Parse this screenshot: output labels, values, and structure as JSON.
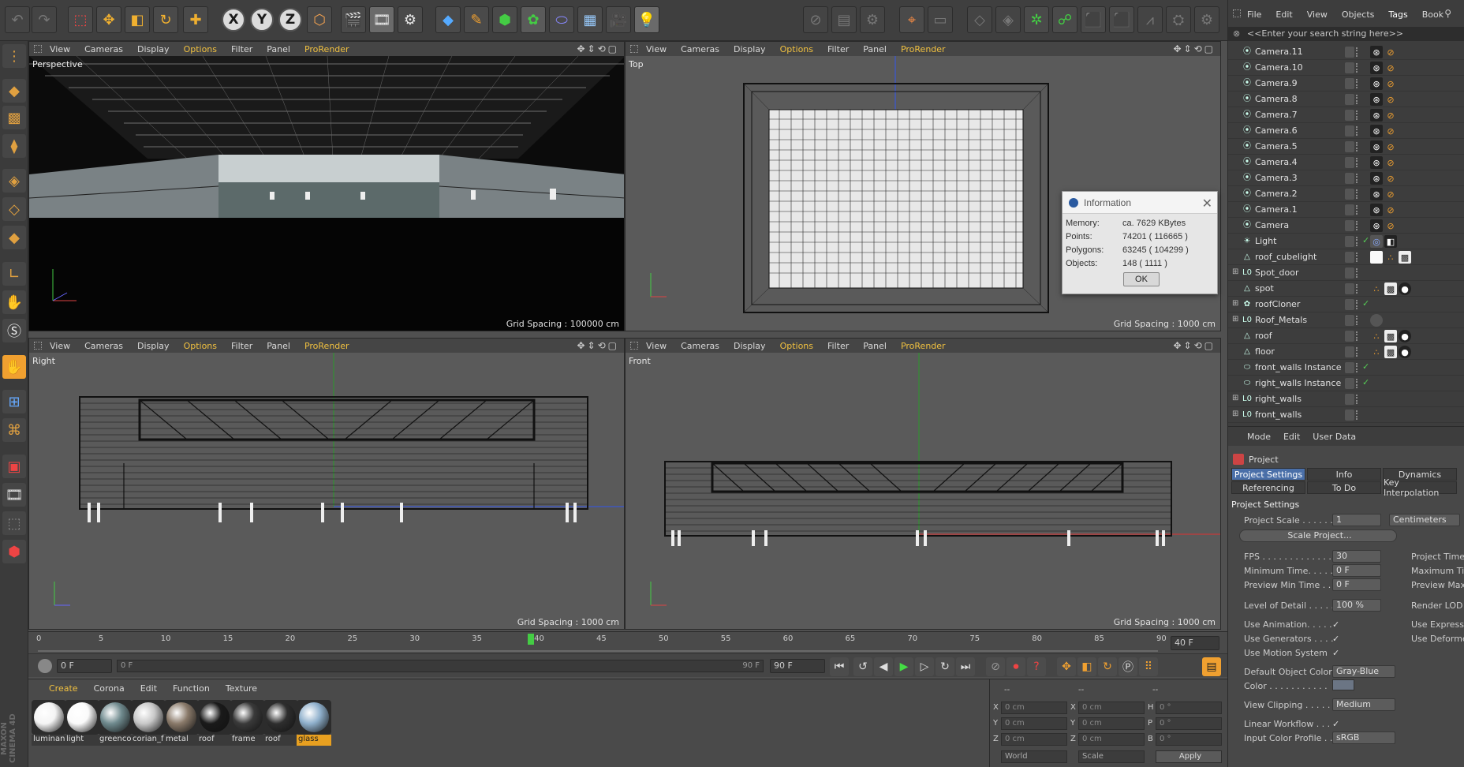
{
  "app": {
    "brand": "MAXON CINEMA 4D"
  },
  "viewports": [
    {
      "id": "perspective",
      "menu": [
        "View",
        "Cameras",
        "Display",
        "Options",
        "Filter",
        "Panel",
        "ProRender"
      ],
      "label": "Perspective",
      "grid": "Grid Spacing : 100000 cm"
    },
    {
      "id": "top",
      "menu": [
        "View",
        "Cameras",
        "Display",
        "Options",
        "Filter",
        "Panel",
        "ProRender"
      ],
      "label": "Top",
      "grid": "Grid Spacing : 1000 cm"
    },
    {
      "id": "right",
      "menu": [
        "View",
        "Cameras",
        "Display",
        "Options",
        "Filter",
        "Panel",
        "ProRender"
      ],
      "label": "Right",
      "grid": "Grid Spacing : 1000 cm"
    },
    {
      "id": "front",
      "menu": [
        "View",
        "Cameras",
        "Display",
        "Options",
        "Filter",
        "Panel",
        "ProRender"
      ],
      "label": "Front",
      "grid": "Grid Spacing : 1000 cm"
    }
  ],
  "info_dialog": {
    "title": "Information",
    "rows": [
      {
        "key": "Memory:",
        "value": "ca. 7629 KBytes"
      },
      {
        "key": "Points:",
        "value": "74201 ( 116665 )"
      },
      {
        "key": "Polygons:",
        "value": "63245 ( 104299 )"
      },
      {
        "key": "Objects:",
        "value": "148 ( 1111 )"
      }
    ],
    "ok_label": "OK"
  },
  "timeline": {
    "ticks": [
      "0",
      "5",
      "10",
      "15",
      "20",
      "25",
      "30",
      "35",
      "40",
      "45",
      "50",
      "55",
      "60",
      "65",
      "70",
      "75",
      "80",
      "85",
      "90"
    ],
    "current_marker": "40",
    "end_field": "40 F",
    "start_field": "0 F",
    "range_left": "0 F",
    "range_right": "90 F",
    "max_field": "90 F"
  },
  "materials": {
    "menu": [
      "Create",
      "Corona",
      "Edit",
      "Function",
      "Texture"
    ],
    "items": [
      {
        "name": "luminan",
        "color": "#f4f4f4"
      },
      {
        "name": "light",
        "color": "#fafafa"
      },
      {
        "name": "greenco",
        "color": "#6f8a8e"
      },
      {
        "name": "corian_f",
        "color": "#c8c8c8"
      },
      {
        "name": "metal",
        "color": "#8a7a6a"
      },
      {
        "name": "roof",
        "color": "#1a1a1a"
      },
      {
        "name": "frame",
        "color": "#3a3a3a"
      },
      {
        "name": "roof",
        "color": "#2e2e2e"
      },
      {
        "name": "glass",
        "color": "#8fb0cc"
      }
    ]
  },
  "coordinates": {
    "headers": [
      "--",
      "--",
      "--"
    ],
    "rows": [
      {
        "a": "X",
        "av": "0 cm",
        "b": "X",
        "bv": "0 cm",
        "c": "H",
        "cv": "0 °"
      },
      {
        "a": "Y",
        "av": "0 cm",
        "b": "Y",
        "bv": "0 cm",
        "c": "P",
        "cv": "0 °"
      },
      {
        "a": "Z",
        "av": "0 cm",
        "b": "Z",
        "bv": "0 cm",
        "c": "B",
        "cv": "0 °"
      }
    ],
    "world": "World",
    "scale": "Scale",
    "apply": "Apply"
  },
  "object_manager": {
    "menu": [
      "File",
      "Edit",
      "View",
      "Objects",
      "Tags",
      "Book"
    ],
    "search_placeholder": "<<Enter your search string here>>",
    "objects": [
      {
        "name": "Camera.11",
        "icon": "camera-icon",
        "group": false
      },
      {
        "name": "Camera.10",
        "icon": "camera-icon",
        "group": false
      },
      {
        "name": "Camera.9",
        "icon": "camera-icon",
        "group": false
      },
      {
        "name": "Camera.8",
        "icon": "camera-icon",
        "group": false
      },
      {
        "name": "Camera.7",
        "icon": "camera-icon",
        "group": false
      },
      {
        "name": "Camera.6",
        "icon": "camera-icon",
        "group": false
      },
      {
        "name": "Camera.5",
        "icon": "camera-icon",
        "group": false
      },
      {
        "name": "Camera.4",
        "icon": "camera-icon",
        "group": false
      },
      {
        "name": "Camera.3",
        "icon": "camera-icon",
        "group": false
      },
      {
        "name": "Camera.2",
        "icon": "camera-icon",
        "group": false
      },
      {
        "name": "Camera.1",
        "icon": "camera-icon",
        "group": false
      },
      {
        "name": "Camera",
        "icon": "camera-icon",
        "group": false
      },
      {
        "name": "Light",
        "icon": "light-icon",
        "group": false
      },
      {
        "name": "roof_cubelight",
        "icon": "polygon-icon",
        "group": false
      },
      {
        "name": "Spot_door",
        "icon": "null-icon",
        "group": true
      },
      {
        "name": "spot",
        "icon": "polygon-icon",
        "group": false
      },
      {
        "name": "roofCloner",
        "icon": "cloner-icon",
        "group": true
      },
      {
        "name": "Roof_Metals",
        "icon": "null-icon",
        "group": true
      },
      {
        "name": "roof",
        "icon": "polygon-icon",
        "group": false
      },
      {
        "name": "floor",
        "icon": "polygon-icon",
        "group": false
      },
      {
        "name": "front_walls Instance",
        "icon": "instance-icon",
        "group": false
      },
      {
        "name": "right_walls Instance",
        "icon": "instance-icon",
        "group": false
      },
      {
        "name": "right_walls",
        "icon": "null-icon",
        "group": true
      },
      {
        "name": "front_walls",
        "icon": "null-icon",
        "group": true
      }
    ]
  },
  "attribute_manager": {
    "menu": [
      "Mode",
      "Edit",
      "User Data"
    ],
    "object": "Project",
    "tabs": [
      "Project Settings",
      "Info",
      "Dynamics",
      "Referencing",
      "To Do",
      "Key Interpolation"
    ],
    "section": "Project Settings",
    "project_scale_label": "Project Scale . . . . . .",
    "project_scale": "1",
    "project_scale_unit": "Centimeters",
    "scale_project_btn": "Scale Project...",
    "fps_label": "FPS . . . . . . . . . . . . .",
    "fps": "30",
    "min_time_label": "Minimum Time. . . . .",
    "min_time": "0 F",
    "preview_min_label": "Preview Min Time . .",
    "preview_min": "0 F",
    "project_time_label": "Project Time",
    "max_time_label": "Maximum Tim",
    "preview_max_label": "Preview Max",
    "lod_label": "Level of Detail . . . . .",
    "lod": "100 %",
    "render_lod_label": "Render LOD i",
    "use_animation_label": "Use Animation. . . . .",
    "use_generators_label": "Use Generators . . . .",
    "use_motion_label": "Use Motion System",
    "use_expression_label": "Use Expressio",
    "use_deformers_label": "Use Deforme",
    "default_color_label": "Default Object Color",
    "default_color": "Gray-Blue",
    "color_label": "Color . . . . . . . . . . .",
    "view_clipping_label": "View Clipping . . . . .",
    "view_clipping": "Medium",
    "linear_workflow_label": "Linear Workflow . . .",
    "input_profile_label": "Input Color Profile . .",
    "input_profile": "sRGB"
  }
}
